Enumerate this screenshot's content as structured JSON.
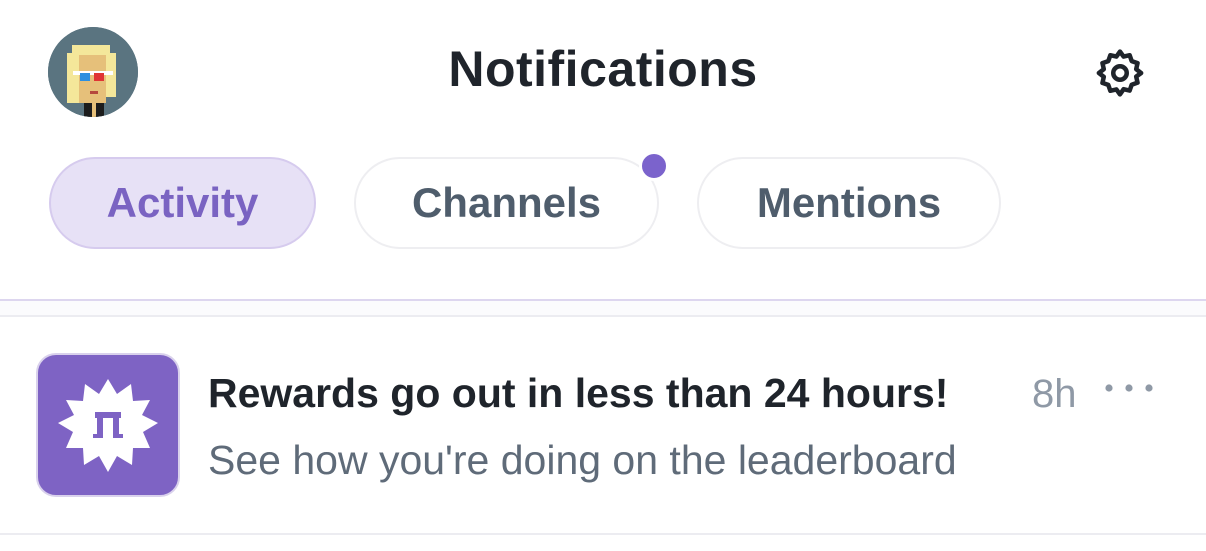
{
  "header": {
    "title": "Notifications",
    "avatar_icon": "pixel-art-avatar",
    "settings_icon": "gear-icon"
  },
  "tabs": [
    {
      "label": "Activity",
      "active": true
    },
    {
      "label": "Channels",
      "active": false,
      "has_unread_dot": true
    },
    {
      "label": "Mentions",
      "active": false
    }
  ],
  "notifications": [
    {
      "icon": "rewards-badge-icon",
      "title": "Rewards go out in less than 24 hours!",
      "time": "8h",
      "body": "See how you're doing on the leaderboard",
      "more_icon": "more-horizontal-icon"
    }
  ],
  "colors": {
    "accent": "#7b63cc",
    "active_tab_bg": "#e7e1f6",
    "title_text": "#1f242b",
    "secondary_text": "#5f6b79"
  }
}
